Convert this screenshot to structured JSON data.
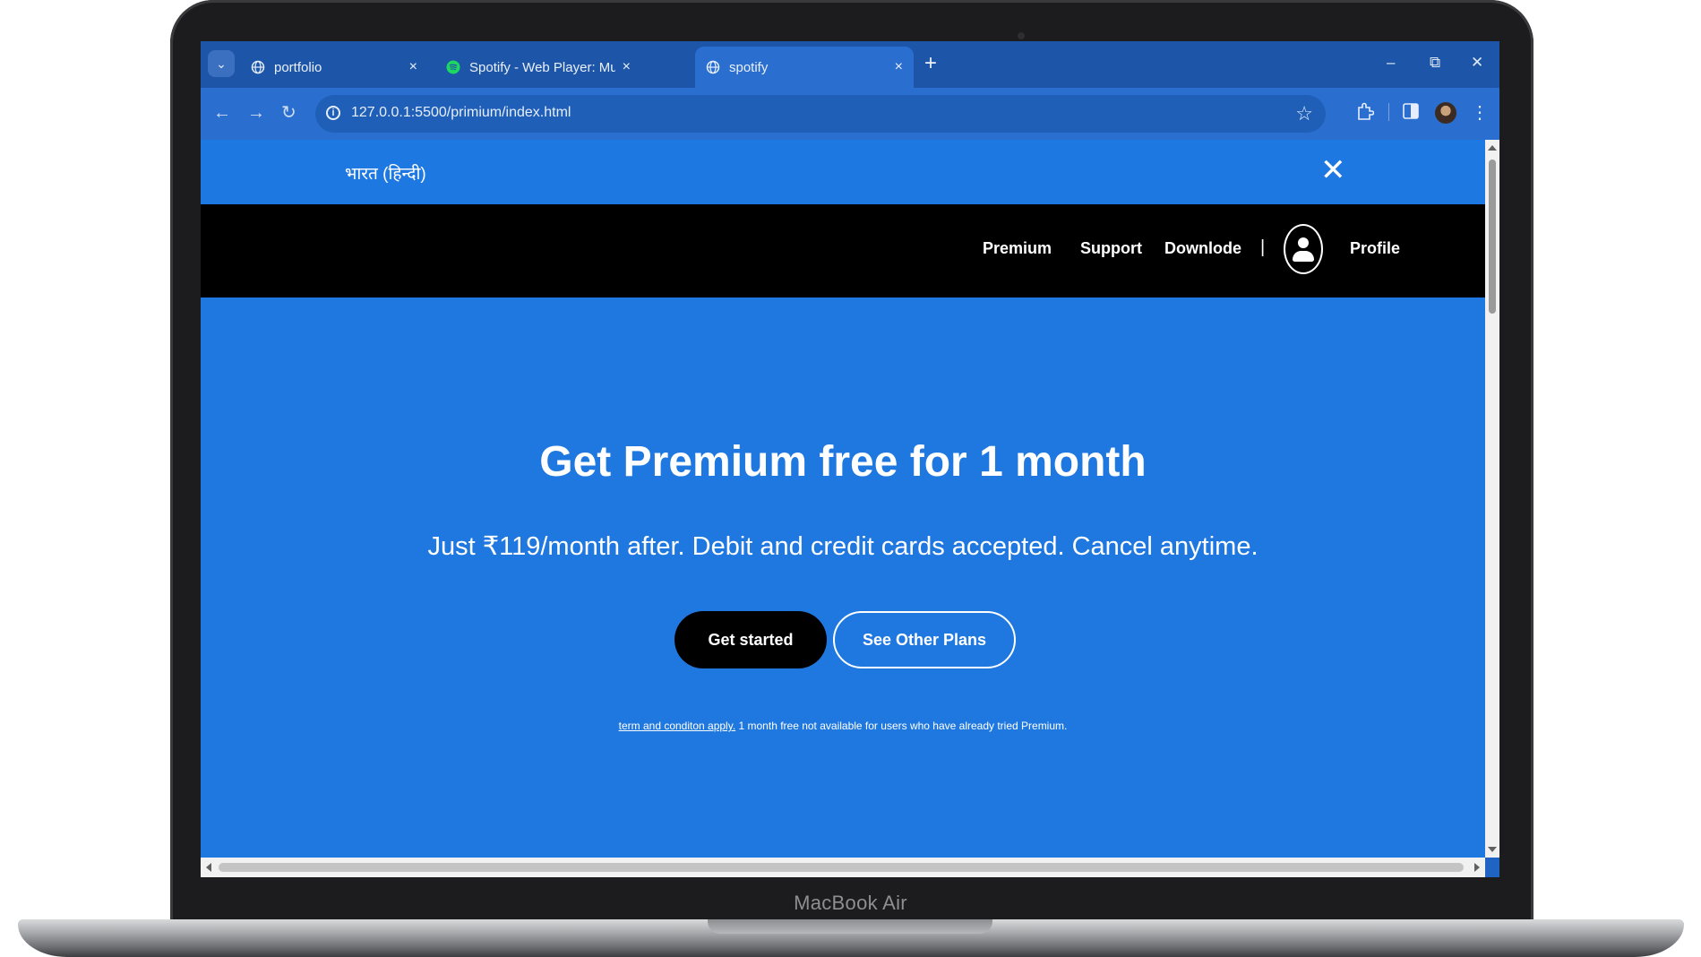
{
  "device": {
    "label": "MacBook Air"
  },
  "browser": {
    "tabs": [
      {
        "title": "portfolio",
        "icon": "globe-icon",
        "active": false
      },
      {
        "title": "Spotify - Web Player: Music for",
        "icon": "spotify-icon",
        "active": false
      },
      {
        "title": "spotify",
        "icon": "globe-icon",
        "active": true
      }
    ],
    "new_tab_symbol": "+",
    "tab_close_symbol": "×",
    "address": {
      "url": "127.0.0.1:5500/primium/index.html"
    },
    "window_controls": {
      "minimize": "–",
      "restore": "⧉",
      "close": "✕"
    }
  },
  "page": {
    "language_banner": {
      "text": "भारत (हिन्दी)",
      "close_symbol": "✕"
    },
    "nav": {
      "links": [
        "Premium",
        "Support",
        "Downlode"
      ],
      "separator": "|",
      "profile_label": "Profile"
    },
    "hero": {
      "title": "Get Premium free for 1 month",
      "subtitle": "Just ₹119/month after. Debit and credit cards accepted. Cancel anytime.",
      "primary_button": "Get started",
      "secondary_button": "See Other Plans",
      "terms_link": "term and conditon apply.",
      "terms_note": " 1 month free not available for users who have already tried Premium."
    }
  },
  "colors": {
    "banner_blue": "#1e78e2",
    "hero_blue": "#1f78e0",
    "navbar_black": "#000000",
    "browser_chrome": "#1d56a8",
    "spotify_green": "#1ed760"
  }
}
